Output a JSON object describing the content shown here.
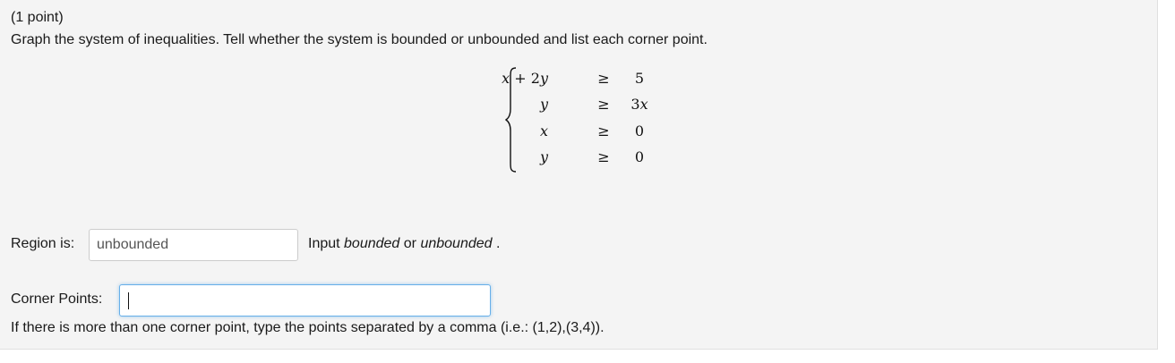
{
  "problem": {
    "points": "(1 point)",
    "instructions": "Graph the system of inequalities. Tell whether the system is bounded or unbounded and list each corner point."
  },
  "system": {
    "rows": [
      {
        "lhs_var1": "x",
        "lhs_op": " + ",
        "lhs_coef": "2",
        "lhs_var2": "y",
        "relation": "≥",
        "rhs_coef": "",
        "rhs_var": "",
        "rhs_num": "5"
      },
      {
        "lhs_var1": "",
        "lhs_op": "",
        "lhs_coef": "",
        "lhs_var2": "y",
        "relation": "≥",
        "rhs_coef": "3",
        "rhs_var": "x",
        "rhs_num": ""
      },
      {
        "lhs_var1": "",
        "lhs_op": "",
        "lhs_coef": "",
        "lhs_var2": "x",
        "relation": "≥",
        "rhs_coef": "",
        "rhs_var": "",
        "rhs_num": "0"
      },
      {
        "lhs_var1": "",
        "lhs_op": "",
        "lhs_coef": "",
        "lhs_var2": "y",
        "relation": "≥",
        "rhs_coef": "",
        "rhs_var": "",
        "rhs_num": "0"
      }
    ]
  },
  "region": {
    "label": "Region is:",
    "value": "unbounded",
    "hint_prefix": "Input ",
    "hint_option1": "bounded",
    "hint_or": " or ",
    "hint_option2": "unbounded",
    "hint_suffix": " ."
  },
  "corner_points": {
    "label": "Corner Points:",
    "value": "",
    "hint": "If there is more than one corner point, type the points separated by a comma (i.e.: (1,2),(3,4))."
  },
  "colors": {
    "panel_background": "#f4f4f4",
    "focus_border": "#66afe9",
    "input_border": "#cccccc"
  }
}
